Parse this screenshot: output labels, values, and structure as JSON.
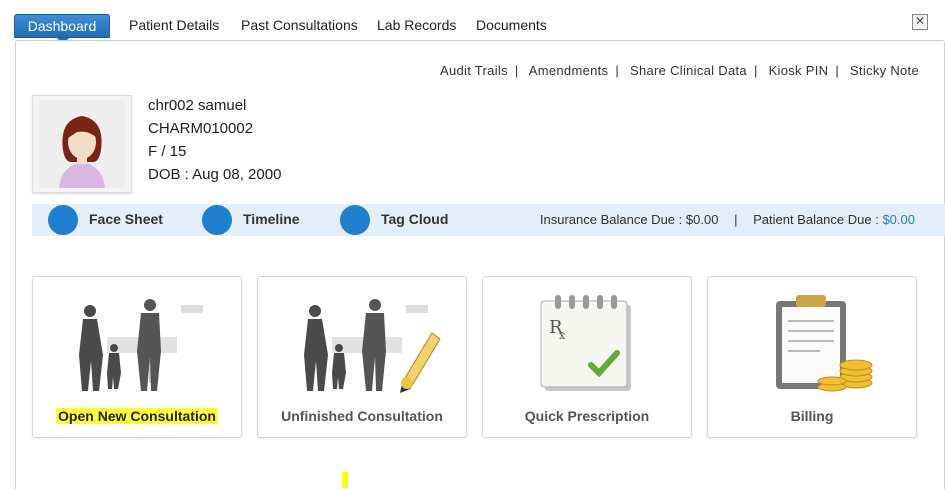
{
  "tabs": [
    {
      "label": "Dashboard",
      "active": true
    },
    {
      "label": "Patient Details"
    },
    {
      "label": "Past Consultations"
    },
    {
      "label": "Lab Records"
    },
    {
      "label": "Documents"
    }
  ],
  "close_icon": "close-icon",
  "top_links": [
    "Audit Trails",
    "Amendments",
    "Share Clinical Data",
    "Kiosk PIN",
    "Sticky Note"
  ],
  "patient": {
    "name": "chr002 samuel",
    "id": "CHARM010002",
    "sex_age": "F / 15",
    "dob": "DOB : Aug 08, 2000"
  },
  "nav_strip": {
    "items": [
      "Face Sheet",
      "Timeline",
      "Tag Cloud"
    ],
    "insurance_label": "Insurance Balance Due :",
    "insurance_value": "$0.00",
    "separator": "|",
    "patient_label": "Patient Balance Due :",
    "patient_value": "$0.00"
  },
  "cards": [
    {
      "label": "Open New Consultation",
      "highlighted": true
    },
    {
      "label": "Unfinished Consultation"
    },
    {
      "label": "Quick Prescription"
    },
    {
      "label": "Billing"
    }
  ],
  "colors": {
    "accent": "#1e7fcf",
    "strip_bg": "#e4eef9",
    "highlight": "#ffff2e"
  }
}
